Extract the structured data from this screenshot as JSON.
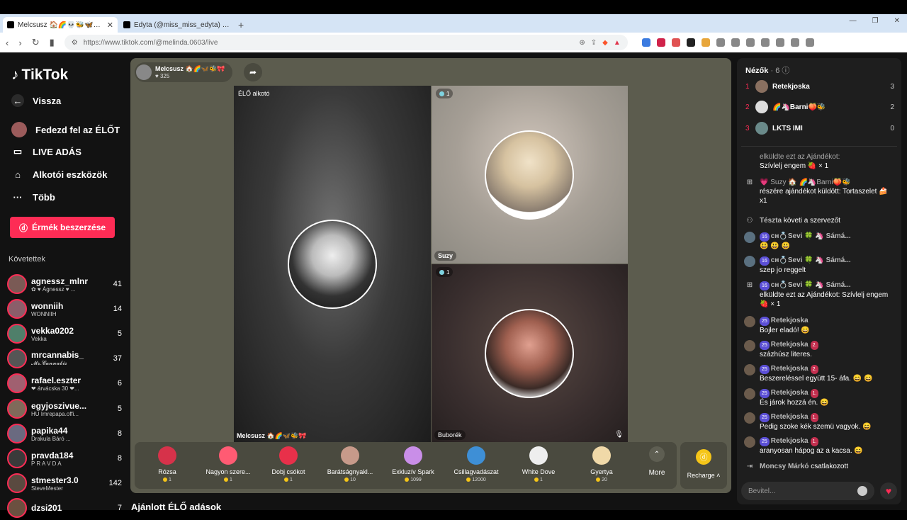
{
  "browser": {
    "tabs": [
      {
        "title": "Melcsusz 🏠🌈💀🐝🦋🎀 (@",
        "active": true
      },
      {
        "title": "Edyta (@miss_miss_edyta) ÉLŐ adá",
        "active": false
      }
    ],
    "url": "https://www.tiktok.com/@melinda.0603/live"
  },
  "sidebar": {
    "logo": "TikTok",
    "nav": [
      {
        "label": "Vissza",
        "icon": "back-arrow-icon"
      },
      {
        "label": "Fedezd fel az ÉLŐT",
        "icon": "explore-live-icon"
      },
      {
        "label": "LIVE ADÁS",
        "icon": "live-camera-icon"
      },
      {
        "label": "Alkotói eszközök",
        "icon": "home-creator-icon"
      },
      {
        "label": "Több",
        "icon": "more-dots-icon"
      }
    ],
    "coins_button": "Érmék beszerzése",
    "following_title": "Követettek",
    "following": [
      {
        "name": "agnessz_mlnr",
        "sub": "✿ ♥ Ágnessz ♥ ...",
        "count": "41"
      },
      {
        "name": "wonniih",
        "sub": "WONNIIH",
        "count": "14"
      },
      {
        "name": "vekka0202",
        "sub": "Vekka",
        "count": "5"
      },
      {
        "name": "mrcannabis_",
        "sub": "𝓜𝓻.𝓒𝓪𝓷𝓷𝓪𝓫𝓲𝓼",
        "count": "37"
      },
      {
        "name": "rafael.eszter",
        "sub": "❤ árvácska 30 ❤...",
        "count": "6"
      },
      {
        "name": "egyjoszivue...",
        "sub": "HU Imrepapa.offi...",
        "count": "5"
      },
      {
        "name": "papika44",
        "sub": "Drakula Báró ...",
        "count": "8"
      },
      {
        "name": "pravda184",
        "sub": "P R A V D A",
        "count": "8"
      },
      {
        "name": "stmester3.0",
        "sub": "SteveMester",
        "count": "142"
      },
      {
        "name": "dzsi201",
        "sub": "",
        "count": "7"
      }
    ]
  },
  "stream": {
    "host_name": "Melcsusz 🏠🌈🦋🐝🎀",
    "host_likes": "325",
    "panels": {
      "main_label": "ÉLŐ alkotó",
      "main_name": "Melcsusz 🏠🌈🦋🐝🎀",
      "top_right_badge": "1",
      "top_right_name": "Suzy",
      "bottom_right_badge": "1",
      "bottom_right_name": "Buborék"
    },
    "gifts": [
      {
        "name": "Rózsa",
        "price": "1",
        "color": "#d6324a"
      },
      {
        "name": "Nagyon szere...",
        "price": "1",
        "color": "#ff5b73"
      },
      {
        "name": "Dobj csókot",
        "price": "1",
        "color": "#e8304a"
      },
      {
        "name": "Barátságnyakl...",
        "price": "10",
        "color": "#c79a8a"
      },
      {
        "name": "Exkluzív Spark",
        "price": "1099",
        "color": "#c98ee8"
      },
      {
        "name": "Csillagvadászat",
        "price": "12000",
        "color": "#3e8fd6"
      },
      {
        "name": "White Dove",
        "price": "1",
        "color": "#eeeeee"
      },
      {
        "name": "Gyertya",
        "price": "20",
        "color": "#f0d9a8"
      }
    ],
    "more_label": "More",
    "recharge_label": "Recharge"
  },
  "recommended_title": "Ajánlott ÉLŐ adások",
  "chat": {
    "viewers_label": "Nézők",
    "viewers_count": "· 6",
    "ranking": [
      {
        "rank": "1",
        "name": "Retekjoska",
        "score": "3"
      },
      {
        "rank": "2",
        "name": "🌈🦄Barni🍑🐝",
        "score": "2"
      },
      {
        "rank": "3",
        "name": "LKTS IMI",
        "score": "0"
      }
    ],
    "messages": [
      {
        "type": "gift",
        "head": "elküldte ezt az Ajándékot:",
        "text": "Szívlelj engem 🍓 × 1"
      },
      {
        "type": "gift",
        "head": "💗 Suzy 🏠 🌈🦄Barni🍑🐝",
        "text": "részére ajándékot küldött: Tortaszelet 🍰 x1"
      },
      {
        "type": "follow",
        "head": "Tészta",
        "text": "követi a szervezőt"
      },
      {
        "type": "chat",
        "level": "16",
        "head": "ᴄʜ💍Sevi 🍀 🦄 Sámá...",
        "text": "😃 😃 😃"
      },
      {
        "type": "chat",
        "level": "16",
        "head": "ᴄʜ💍Sevi 🍀 🦄 Sámá...",
        "text": "szep jo reggelt"
      },
      {
        "type": "gift",
        "level": "16",
        "head": "ᴄʜ💍Sevi 🍀 🦄 Sámá...",
        "text": "elküldte ezt az Ajándékot: Szívlelj engem 🍓 × 1"
      },
      {
        "type": "chat",
        "level": "25",
        "head": "Retekjoska",
        "text": "Bojler eladó! 😄"
      },
      {
        "type": "chat",
        "level": "25",
        "head": "Retekjoska",
        "fan": "2.",
        "text": "százhúsz literes."
      },
      {
        "type": "chat",
        "level": "25",
        "head": "Retekjoska",
        "fan": "2.",
        "text": "Beszereléssel együtt 15- áfa. 😄 😄"
      },
      {
        "type": "chat",
        "level": "25",
        "head": "Retekjoska",
        "fan": "1.",
        "text": "És járok hozzá én. 😄"
      },
      {
        "type": "chat",
        "level": "25",
        "head": "Retekjoska",
        "fan": "1.",
        "text": "Pedig szoke kék szemü vagyok. 😄"
      },
      {
        "type": "chat",
        "level": "25",
        "head": "Retekjoska",
        "fan": "1.",
        "text": "aranyosan hápog az a kacsa. 😄"
      },
      {
        "type": "join",
        "head": "Moncsy Márkó",
        "text": "csatlakozott"
      }
    ],
    "input_placeholder": "Bevitel..."
  }
}
